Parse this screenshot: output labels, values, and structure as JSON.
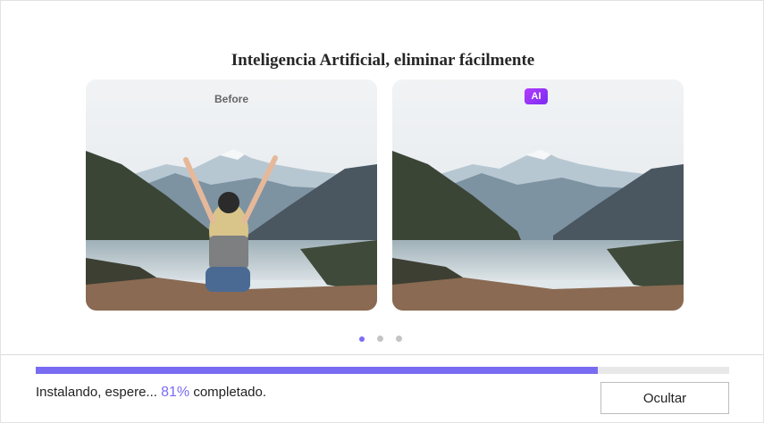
{
  "carousel": {
    "title": "Inteligencia Artificial, eliminar fácilmente",
    "before_label": "Before",
    "after_badge": "AI",
    "dots": [
      {
        "active": true
      },
      {
        "active": false
      },
      {
        "active": false
      }
    ]
  },
  "install": {
    "progress_percent": 81,
    "status_prefix": "Instalando, espere...",
    "status_percent": "81%",
    "status_suffix": "completado.",
    "hide_button": "Ocultar"
  },
  "colors": {
    "accent": "#7a6cf2",
    "ai_badge": "#9b34f8"
  }
}
